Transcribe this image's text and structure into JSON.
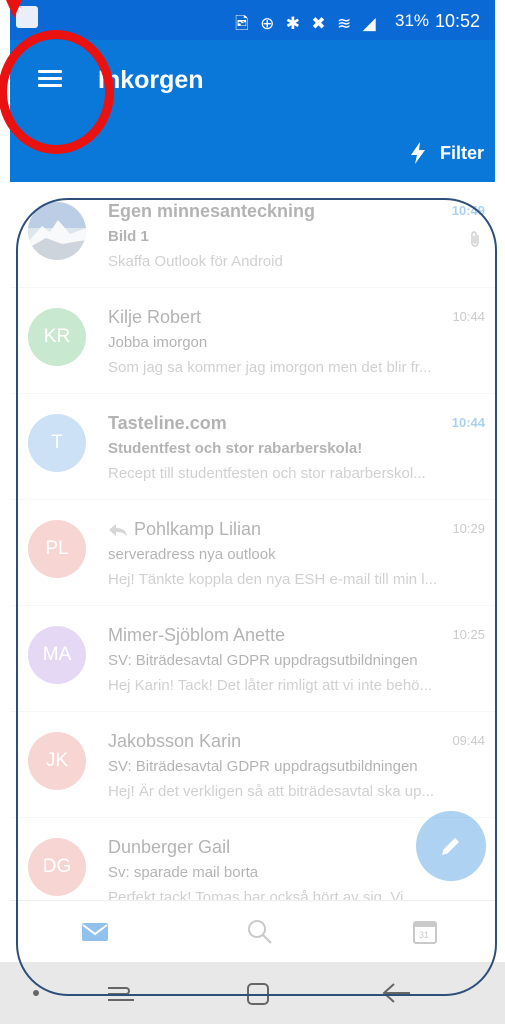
{
  "status_bar": {
    "icons_text": "🖻 ⊕ ✱ ✖ ≋ ◢",
    "battery": "31%",
    "time": "10:52"
  },
  "app_bar": {
    "title": "Inkorgen",
    "filter_label": "Filter"
  },
  "messages": [
    {
      "sender": "Egen minnesanteckning",
      "subject": "Bild 1",
      "preview": "Skaffa Outlook för Android",
      "time": "10:49",
      "unread": true,
      "avatar_text": "",
      "avatar_color": "#8fa2b8",
      "has_attachment": true,
      "replied": false
    },
    {
      "sender": "Kilje Robert",
      "subject": "Jobba imorgon",
      "preview": "Som jag sa kommer jag imorgon men det blir fr...",
      "time": "10:44",
      "unread": false,
      "avatar_text": "KR",
      "avatar_color": "#5fbf73",
      "has_attachment": false,
      "replied": false
    },
    {
      "sender": "Tasteline.com",
      "subject": "Studentfest och stor rabarberskola!",
      "preview": "Recept till studentfesten och stor rabarberskol...",
      "time": "10:44",
      "unread": true,
      "avatar_text": "T",
      "avatar_color": "#6aa8e0",
      "has_attachment": false,
      "replied": false
    },
    {
      "sender": "Pohlkamp Lilian",
      "subject": "serveradress nya outlook",
      "preview": "Hej! Tänkte koppla den nya ESH e-mail till min l...",
      "time": "10:29",
      "unread": false,
      "avatar_text": "PL",
      "avatar_color": "#e8837f",
      "has_attachment": false,
      "replied": true
    },
    {
      "sender": "Mimer-Sjöblom Anette",
      "subject": "SV: Biträdesavtal GDPR uppdragsutbildningen",
      "preview": "Hej Karin! Tack! Det låter rimligt att vi inte behö...",
      "time": "10:25",
      "unread": false,
      "avatar_text": "MA",
      "avatar_color": "#b38ee0",
      "has_attachment": false,
      "replied": false
    },
    {
      "sender": "Jakobsson Karin",
      "subject": "SV: Biträdesavtal GDPR uppdragsutbildningen",
      "preview": "Hej! Är det verkligen så att biträdesavtal ska up...",
      "time": "09:44",
      "unread": false,
      "avatar_text": "JK",
      "avatar_color": "#e8837f",
      "has_attachment": false,
      "replied": false
    },
    {
      "sender": "Dunberger Gail",
      "subject": "Sv: sparade mail borta",
      "preview": "Perfekt tack! Tomas har också hört av sig. Vi...",
      "time": "",
      "unread": false,
      "avatar_text": "DG",
      "avatar_color": "#e8837f",
      "has_attachment": false,
      "replied": false
    }
  ],
  "bottom_nav": {
    "calendar_day": "31"
  },
  "colors": {
    "accent": "#0a78d8",
    "status_bar": "#0a69d4",
    "highlight": "#ea1111",
    "outline": "#2d4f7a"
  },
  "icons": [
    "menu-icon",
    "filter-bolt-icon",
    "attachment-icon",
    "reply-icon",
    "compose-pencil-icon",
    "mail-icon",
    "search-icon",
    "calendar-icon"
  ]
}
